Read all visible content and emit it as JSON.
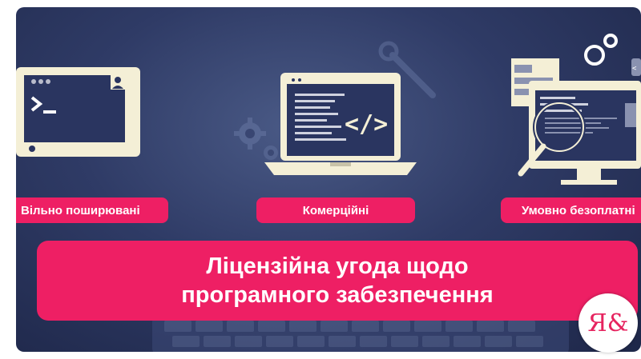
{
  "categories": {
    "free": "Вільно поширювані",
    "commercial": "Комерційні",
    "shareware": "Умовно безоплатні"
  },
  "banner": {
    "line1": "Ліцензійна угода щодо",
    "line2": "програмного забезпечення"
  },
  "logo": {
    "text": "Я&"
  },
  "colors": {
    "accent": "#ee1f64",
    "background": "#2f3b66",
    "device_frame": "#f4efd6",
    "screen": "#2a3560"
  },
  "icons": [
    "terminal-monitor-icon",
    "code-laptop-icon",
    "code-desktop-magnifier-icon",
    "gear-icon",
    "wrench-icon",
    "keyboard-icon"
  ]
}
